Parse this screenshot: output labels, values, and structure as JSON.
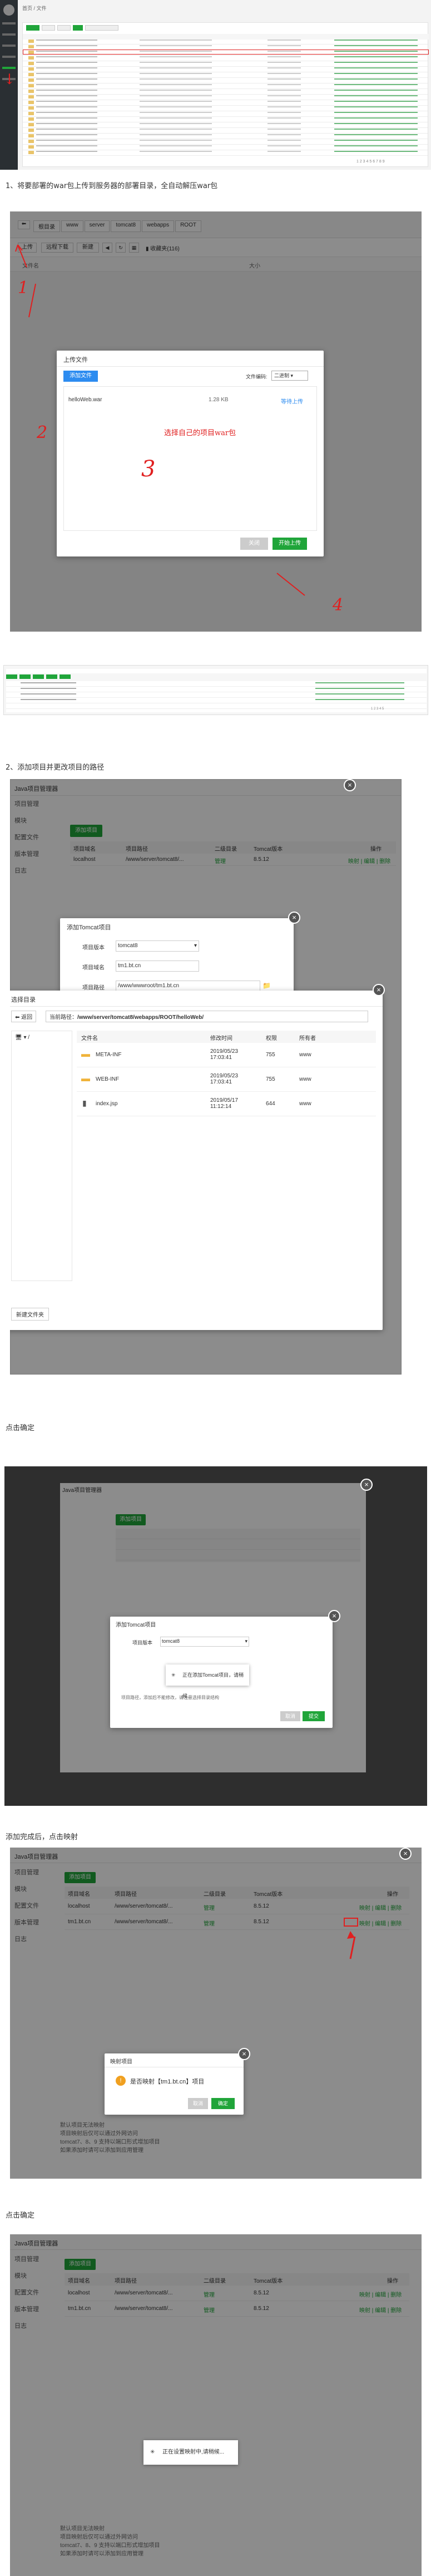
{
  "captions": {
    "step1": "1、将要部署的war包上传到服务器的部署目录，全自动解压war包",
    "step2": "2、添加项目并更改项目的路径",
    "confirm1": "点击确定",
    "after_add": "添加完成后，点击映射",
    "confirm2": "点击确定"
  },
  "shot1": {
    "top_tabs": [
      "首页",
      "文件"
    ],
    "pagination": "1 2 3 4 5 6 7 8 9"
  },
  "shot2": {
    "back_label": "返回",
    "breadcrumb": [
      "根目录",
      "www",
      "server",
      "tomcat8",
      "webapps",
      "ROOT"
    ],
    "toolbar": {
      "upload": "上传",
      "remote": "远程下载",
      "new": "新建",
      "fav": "收藏夹(116)"
    },
    "col_name": "文件名",
    "col_size": "大小",
    "upload_dialog": {
      "title": "上传文件",
      "add_files": "添加文件",
      "encoding_label": "文件编码:",
      "encoding_value": "二进制",
      "file_name": "helloWeb.war",
      "file_size": "1.28 KB",
      "pending": "等待上传",
      "hint": "选择自己的项目war包",
      "close": "关闭",
      "start": "开始上传"
    },
    "annotations": [
      "1",
      "2",
      "3",
      "4"
    ]
  },
  "shot3": {
    "pagination": "1 2 3 4 5"
  },
  "java_mgr": {
    "title": "Java项目管理器",
    "menu": [
      "项目管理",
      "模块",
      "配置文件",
      "版本管理",
      "日志"
    ],
    "add_button": "添加项目",
    "headers": [
      "项目域名",
      "项目路径",
      "二级目录",
      "Tomcat版本",
      "操作"
    ],
    "rows": [
      {
        "domain": "localhost",
        "path": "/www/server/tomcat8/...",
        "manage": "管理",
        "ver": "8.5.12",
        "ops": "映射 | 编辑 | 删除"
      },
      {
        "domain": "tm1.bt.cn",
        "path": "/www/server/tomcat8/...",
        "manage": "管理",
        "ver": "8.5.12",
        "ops": "映射 | 编辑 | 删除"
      }
    ],
    "tips": [
      "默认项目无法映射",
      "项目映射后仅可以通过外网访问",
      "tomcat7、8、9 支持以端口形式增加项目",
      "如果添加时请可以添加到应用管理"
    ]
  },
  "add_dialog": {
    "title": "添加Tomcat项目",
    "version_label": "项目版本",
    "version_value": "tomcat8",
    "domain_label": "项目域名",
    "domain_value": "tm1.bt.cn",
    "path_label": "项目路径",
    "path_value": "/www/wwwroot/tm1.bt.cn",
    "note": "项目路径，添加后不能修改，请注意选择目录结构",
    "cancel": "取消",
    "submit": "提交"
  },
  "dir_dialog": {
    "title": "选择目录",
    "back": "返回",
    "current_label": "当前路径：",
    "current_path": "/www/server/tomcat8/webapps/ROOT/helloWeb/",
    "tree_root": "/",
    "cols": [
      "文件名",
      "修改时间",
      "权限",
      "所有者"
    ],
    "items": [
      {
        "name": "META-INF",
        "time": "2019/05/23 17:03:41",
        "perm": "755",
        "owner": "www"
      },
      {
        "name": "WEB-INF",
        "time": "2019/05/23 17:03:41",
        "perm": "755",
        "owner": "www"
      },
      {
        "name": "index.jsp",
        "time": "2019/05/17 11:12:14",
        "perm": "644",
        "owner": "www"
      }
    ],
    "new_folder": "新建文件夹"
  },
  "loading1": "正在添加Tomcat项目，请稍候...",
  "map_dialog": {
    "title": "映射项目",
    "question": "是否映射【tm1.bt.cn】项目",
    "cancel": "取消",
    "confirm": "确定"
  },
  "loading2": "正在设置映射中,请稍候..."
}
